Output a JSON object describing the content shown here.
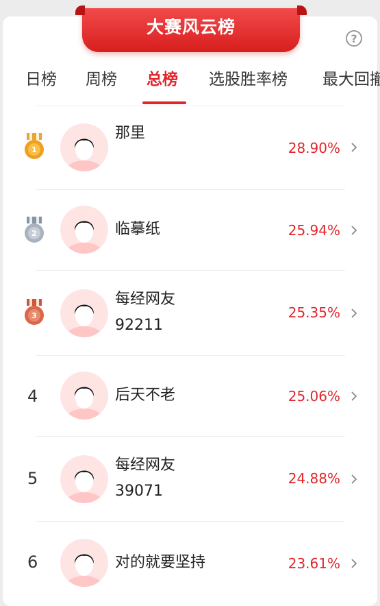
{
  "header": {
    "title": "大赛风云榜",
    "help_label": "?"
  },
  "tabs": [
    {
      "label": "日榜",
      "active": false
    },
    {
      "label": "周榜",
      "active": false
    },
    {
      "label": "总榜",
      "active": true
    },
    {
      "label": "选股胜率榜",
      "active": false
    },
    {
      "label": "最大回撤",
      "active": false
    }
  ],
  "ranking": [
    {
      "rank": "1",
      "medal": "gold-medal-icon",
      "name_line1": "那里",
      "name_line2": "",
      "return": "28.90%"
    },
    {
      "rank": "2",
      "medal": "silver-medal-icon",
      "name_line1": "临摹纸",
      "name_line2": "",
      "return": "25.94%"
    },
    {
      "rank": "3",
      "medal": "bronze-medal-icon",
      "name_line1": "每经网友",
      "name_line2": "92211",
      "return": "25.35%"
    },
    {
      "rank": "4",
      "medal": "",
      "name_line1": "后天不老",
      "name_line2": "",
      "return": "25.06%"
    },
    {
      "rank": "5",
      "medal": "",
      "name_line1": "每经网友",
      "name_line2": "39071",
      "return": "24.88%"
    },
    {
      "rank": "6",
      "medal": "",
      "name_line1": "对的就要坚持",
      "name_line2": "",
      "return": "23.61%"
    }
  ],
  "colors": {
    "accent": "#e0262a",
    "gold": "#f0a020",
    "silver": "#a9b3bf",
    "bronze": "#d9684a",
    "avatar_bg": "#ffe4e4"
  }
}
